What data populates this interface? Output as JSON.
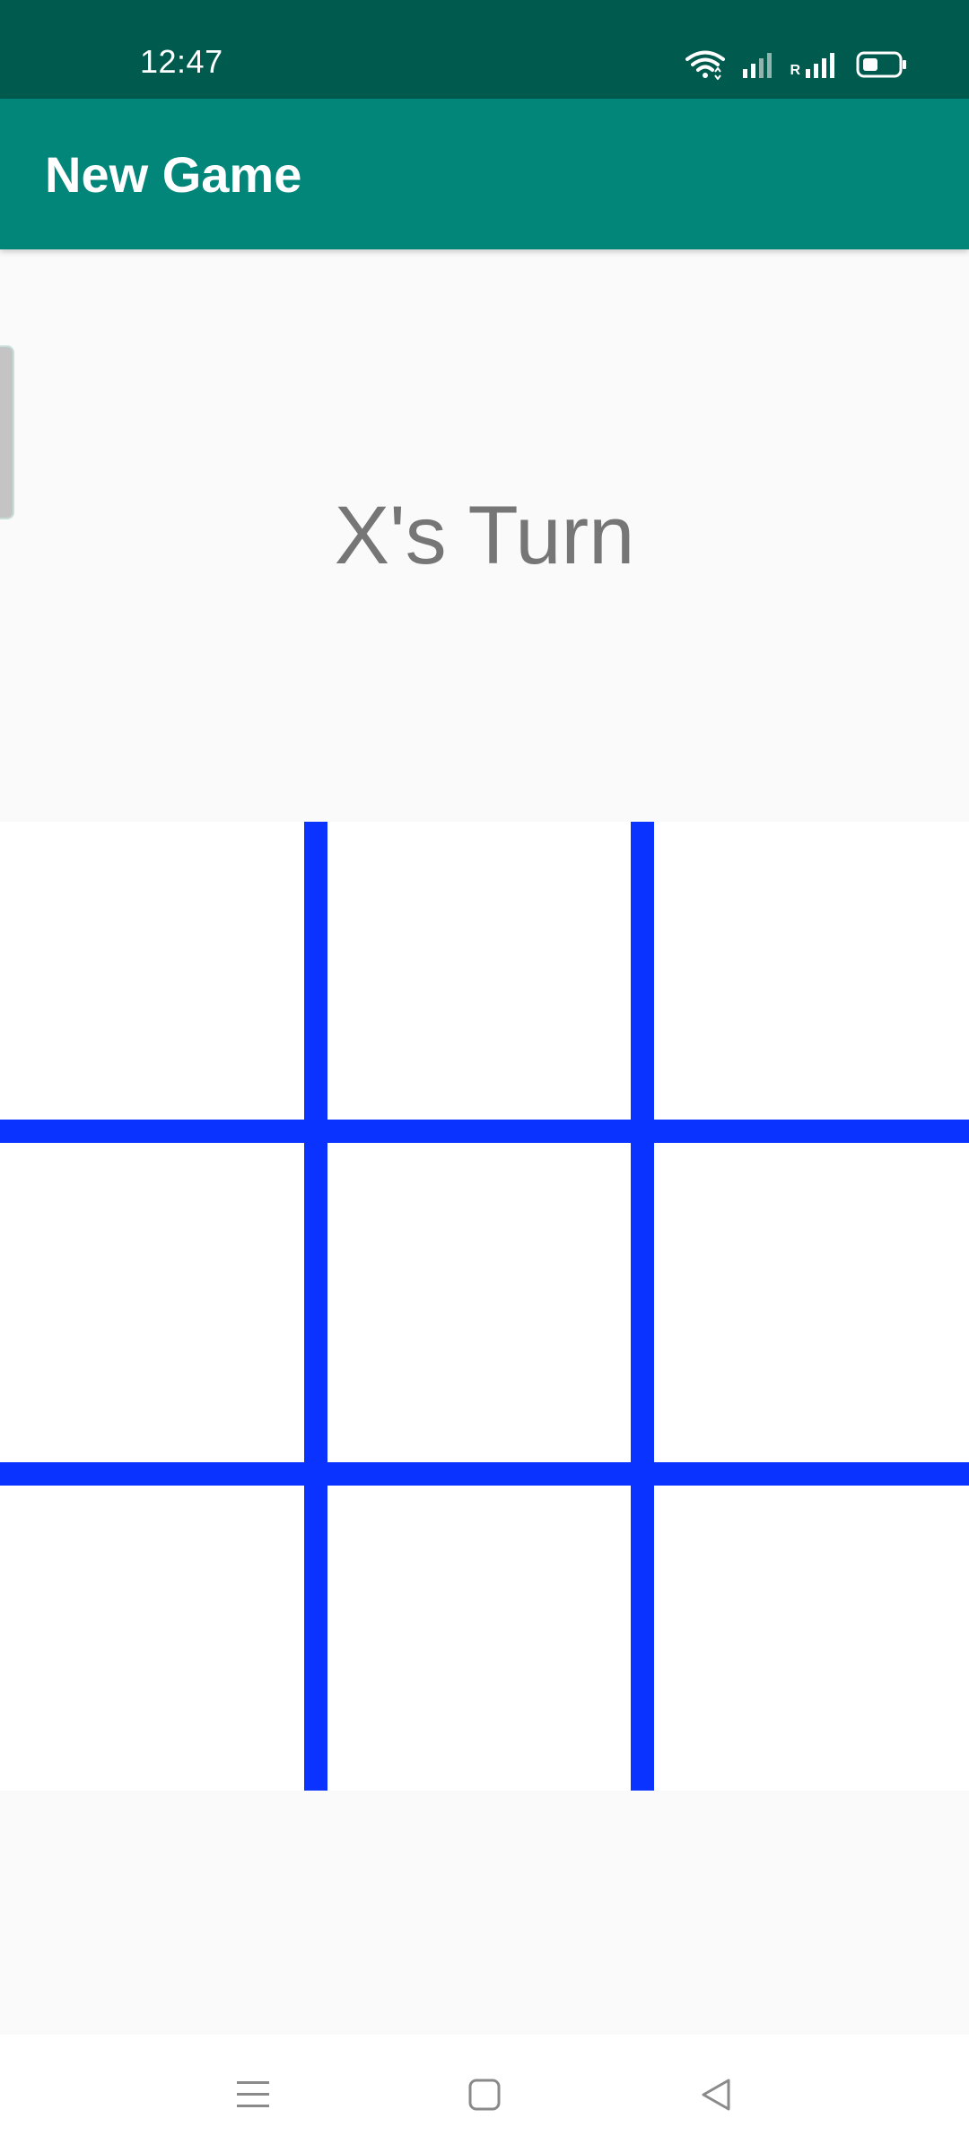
{
  "status_bar": {
    "time": "12:47",
    "network_label": "R",
    "icons": [
      "wifi-icon",
      "signal-icon",
      "roaming-signal-icon",
      "battery-icon"
    ]
  },
  "app_bar": {
    "title": "New Game"
  },
  "game": {
    "turn_text": "X's Turn",
    "board": [
      [
        "",
        "",
        ""
      ],
      [
        "",
        "",
        ""
      ],
      [
        "",
        "",
        ""
      ]
    ]
  },
  "nav_bar": {
    "icons": [
      "menu-icon",
      "home-icon",
      "back-icon"
    ]
  },
  "colors": {
    "status_bar": "#005a4e",
    "app_bar": "#02867a",
    "grid_line": "#0a33ff",
    "turn_text": "#767676",
    "background": "#fafafa"
  }
}
